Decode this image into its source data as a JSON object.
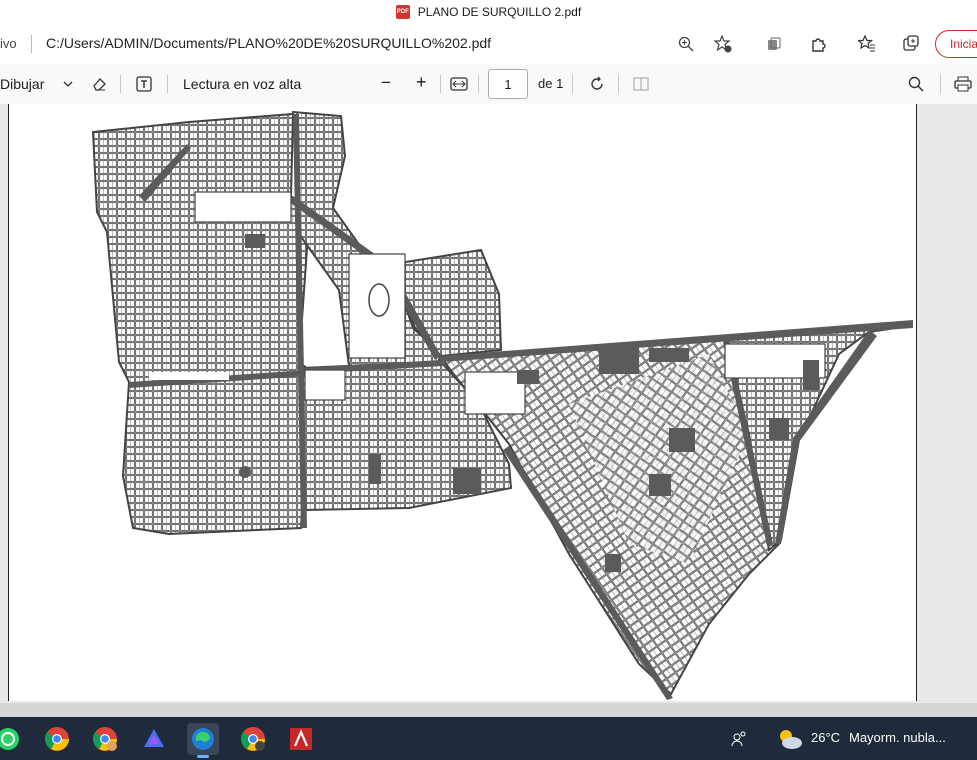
{
  "titlebar": {
    "title": "PLANO DE SURQUILLO 2.pdf",
    "icon": "pdf-file-icon",
    "badge": "PDF"
  },
  "addressbar": {
    "prefix": "ivo",
    "url": "C:/Users/ADMIN/Documents/PLANO%20DE%20SURQUILLO%202.pdf",
    "signin_label": "Inicia",
    "icons": [
      "zoom-icon",
      "favorite-add-icon",
      "collections-icon",
      "extensions-icon",
      "favorites-icon",
      "tab-actions-icon"
    ]
  },
  "pdf_toolbar": {
    "draw_label": "Dibujar",
    "read_aloud_label": "Lectura en voz alta",
    "zoom_out": "−",
    "zoom_in": "+",
    "page_current": "1",
    "page_total_label": "de 1"
  },
  "taskbar": {
    "apps": [
      "whatsapp-icon",
      "chrome-icon",
      "chrome-profile-icon",
      "copilot-icon",
      "edge-icon",
      "chrome-n-icon",
      "autocad-icon"
    ],
    "weather_temp": "26°C",
    "weather_desc": "Mayorm. nubla..."
  },
  "colors": {
    "accent_red": "#c62828",
    "map_fill": "#5b5b5b",
    "taskbar_bg": "#1f2a3c"
  }
}
